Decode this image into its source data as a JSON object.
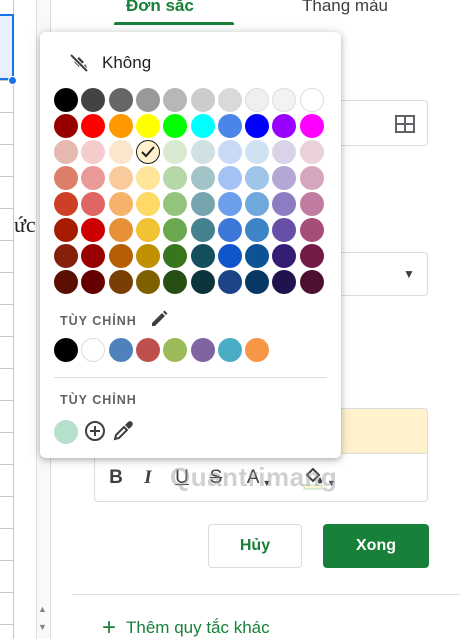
{
  "sheet": {
    "cell_text": "ức:"
  },
  "panel": {
    "tabs": [
      {
        "label": "Đơn sắc",
        "active": true
      },
      {
        "label": "Thang màu",
        "active": false
      }
    ],
    "preview_bg": "#fff2cc",
    "format_buttons": {
      "bold": "B",
      "italic": "I",
      "underline": "U",
      "strike": "S",
      "text_color": "A"
    },
    "watermark": "Quantrimang",
    "cancel_label": "Hủy",
    "done_label": "Xong",
    "add_rule_label": "Thêm quy tắc khác",
    "accent_color": "#188038"
  },
  "picker": {
    "none_label": "Không",
    "palette": [
      [
        "#000000",
        "#434343",
        "#666666",
        "#999999",
        "#b7b7b7",
        "#cccccc",
        "#d9d9d9",
        "#efefef",
        "#f3f3f3",
        "#ffffff"
      ],
      [
        "#980000",
        "#ff0000",
        "#ff9900",
        "#ffff00",
        "#00ff00",
        "#00ffff",
        "#4a86e8",
        "#0000ff",
        "#9900ff",
        "#ff00ff"
      ],
      [
        "#e6b8af",
        "#f4cccc",
        "#fce5cd",
        "#fff2cc",
        "#d9ead3",
        "#d0e0e3",
        "#c9daf8",
        "#cfe2f3",
        "#d9d2e9",
        "#ead1dc"
      ],
      [
        "#dd7e6b",
        "#ea9999",
        "#f9cb9c",
        "#ffe599",
        "#b6d7a8",
        "#a2c4c9",
        "#a4c2f4",
        "#9fc5e8",
        "#b4a7d6",
        "#d5a6bd"
      ],
      [
        "#cc4125",
        "#e06666",
        "#f6b26b",
        "#ffd966",
        "#93c47d",
        "#76a5af",
        "#6d9eeb",
        "#6fa8dc",
        "#8e7cc3",
        "#c27ba0"
      ],
      [
        "#a61c00",
        "#cc0000",
        "#e69138",
        "#f1c232",
        "#6aa84f",
        "#45818e",
        "#3c78d8",
        "#3d85c6",
        "#674ea7",
        "#a64d79"
      ],
      [
        "#85200c",
        "#990000",
        "#b45f06",
        "#bf9000",
        "#38761d",
        "#134f5c",
        "#1155cc",
        "#0b5394",
        "#351c75",
        "#741b47"
      ],
      [
        "#5b0f00",
        "#660000",
        "#783f04",
        "#7f6000",
        "#274e13",
        "#0c343d",
        "#1c4587",
        "#073763",
        "#20124d",
        "#4c1130"
      ]
    ],
    "selected_color": "#fff2cc",
    "custom_label_1": "TÙY CHỈNH",
    "custom_colors": [
      "#000000",
      "#ffffff",
      "#4f81bd",
      "#c0504d",
      "#9bbb59",
      "#8064a2",
      "#4bacc6",
      "#f79646"
    ],
    "custom_label_2": "TÙY CHỈNH",
    "recent_custom_color": "#b7e1cd"
  }
}
